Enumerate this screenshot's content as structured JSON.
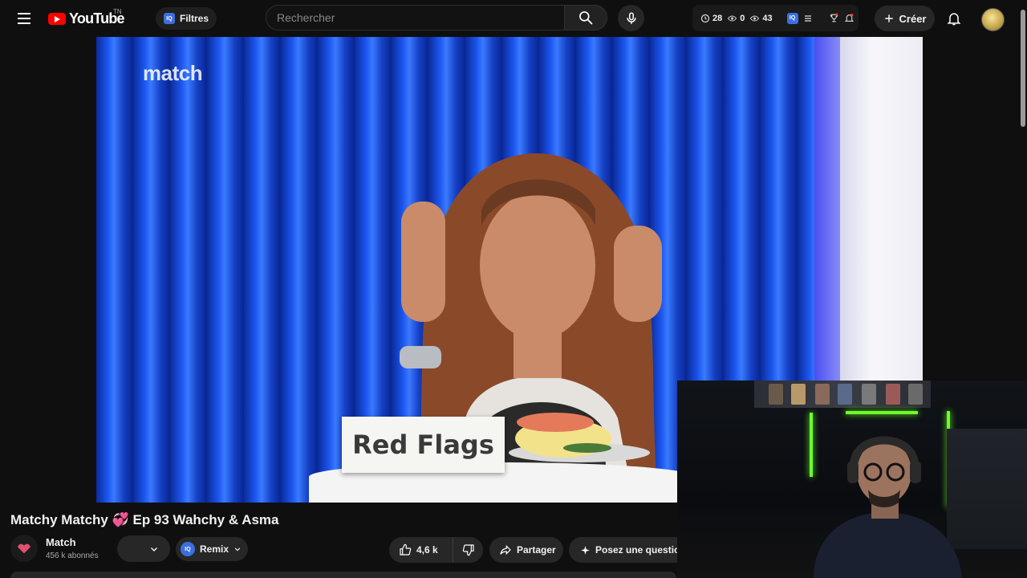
{
  "header": {
    "logo_text": "YouTube",
    "country_code": "TN",
    "filters_label": "Filtres",
    "filters_badge": "IQ",
    "search_placeholder": "Rechercher",
    "stats": {
      "watch_count": "28",
      "views_a": "0",
      "views_b": "43",
      "badge": "IQ"
    },
    "create_label": "Créer"
  },
  "video": {
    "watermark": "match",
    "sign_text": "Red Flags"
  },
  "info": {
    "title": "Matchy Matchy 💞 Ep 93 Wahchy & Asma",
    "channel_name": "Match",
    "subscribers": "456 k abonnés",
    "remix_label": "Remix",
    "remix_badge": "IQ",
    "likes": "4,6 k",
    "share_label": "Partager",
    "ask_label": "Posez une question"
  },
  "colors": {
    "background": "#0f0f0f",
    "button": "#272727",
    "brand_red": "#ff0000",
    "iq_blue": "#3b6fe0",
    "neon_green": "#6dff2a"
  },
  "icons": [
    "menu-icon",
    "youtube-logo-icon",
    "search-icon",
    "mic-icon",
    "clock-icon",
    "eye-icon",
    "list-icon",
    "trophy-icon",
    "bell-alert-icon",
    "plus-icon",
    "bell-icon",
    "chevron-down-icon",
    "thumbs-up-icon",
    "thumbs-down-icon",
    "share-icon",
    "sparkle-icon"
  ]
}
